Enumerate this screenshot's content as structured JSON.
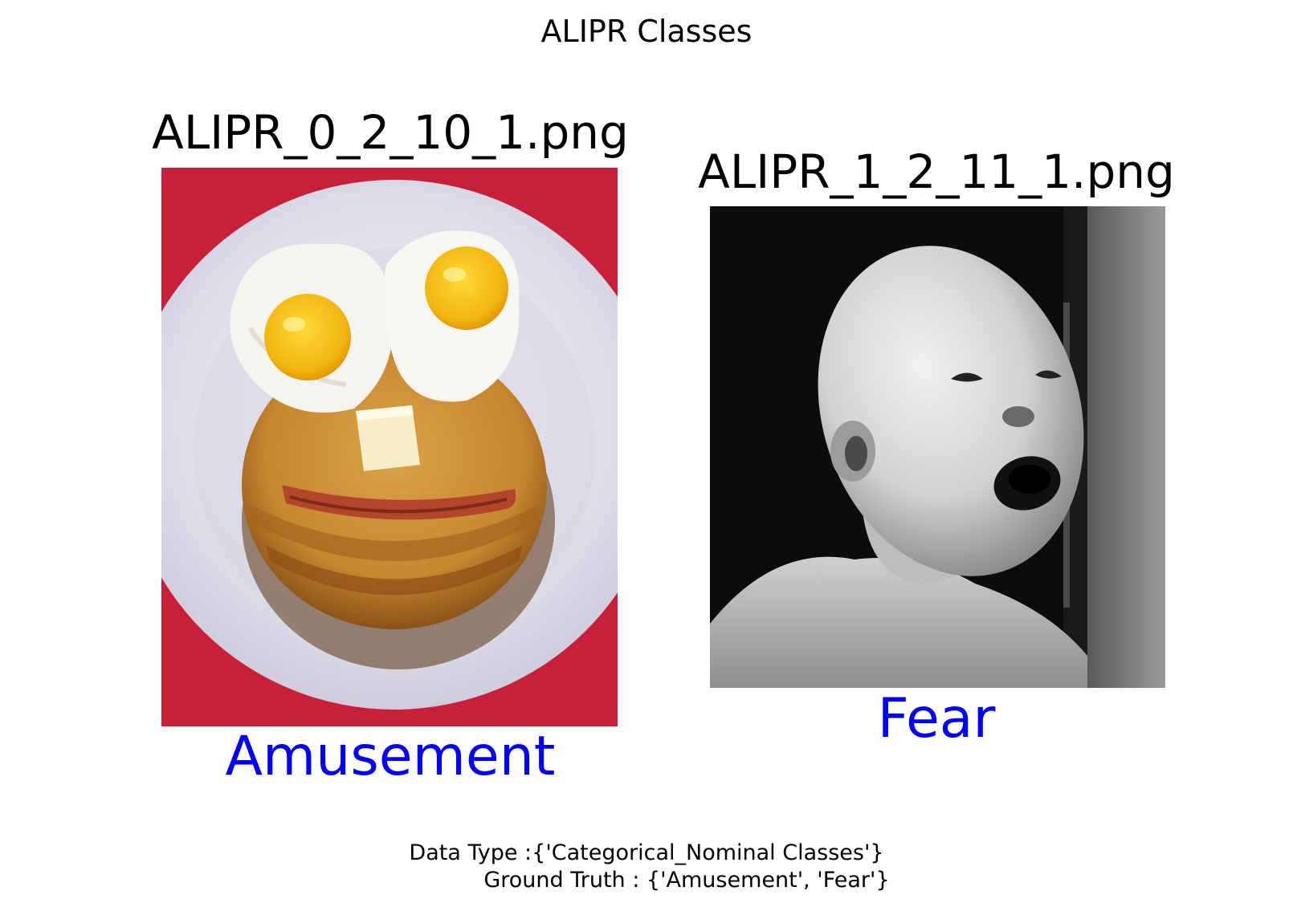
{
  "figure": {
    "title": "ALIPR Classes"
  },
  "panels": [
    {
      "filename": "ALIPR_0_2_10_1.png",
      "label": "Amusement",
      "label_color": "#0000ff",
      "image_content": "pancake-face-photo"
    },
    {
      "filename": "ALIPR_1_2_11_1.png",
      "label": "Fear",
      "label_color": "#0000ff",
      "image_content": "frightened-child-photo"
    }
  ],
  "footer": {
    "data_type_line": "Data Type :{'Categorical_Nominal Classes'}",
    "ground_truth_line": "Ground Truth : {'Amusement', 'Fear'}"
  }
}
